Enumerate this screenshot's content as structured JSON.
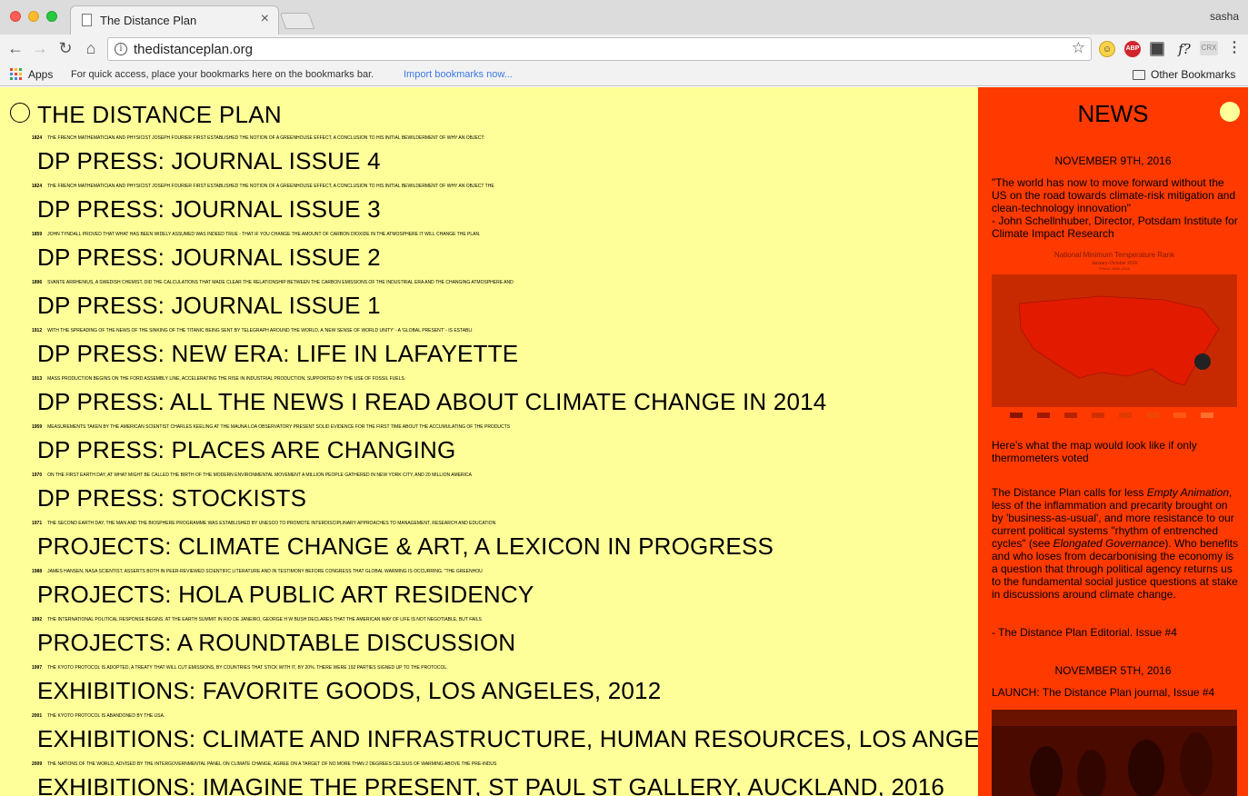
{
  "browser": {
    "tab_title": "The Distance Plan",
    "tab_close": "×",
    "profile_name": "sasha",
    "url": "thedistanceplan.org",
    "bookmarks_apps": "Apps",
    "bookmarks_hint": "For quick access, place your bookmarks here on the bookmarks bar.",
    "bookmarks_import": "Import bookmarks now...",
    "other_bookmarks": "Other Bookmarks",
    "ext_abp": "ABP",
    "ext_f": "f?",
    "ext_crx": "CRX",
    "icons": [
      "back-icon",
      "forward-icon",
      "reload-icon",
      "home-icon",
      "info-icon",
      "star-icon",
      "menu-icon"
    ]
  },
  "colors": {
    "left_bg": "#ffff99",
    "right_bg": "#ff3a00",
    "text": "#000000",
    "link_blue": "#3b78e7"
  },
  "site": {
    "title": "THE DISTANCE PLAN",
    "entries": [
      {
        "year": "1824",
        "note": "THE FRENCH MATHEMATICIAN AND PHYSICIST JOSEPH FOURIER FIRST ESTABLISHED THE NOTION OF A GREENHOUSE EFFECT, A CONCLUSION TO HIS INITIAL BEWILDERMENT OF WHY AN OBJECT:",
        "link": "DP PRESS: JOURNAL ISSUE 4"
      },
      {
        "year": "1824",
        "note": "THE FRENCH MATHEMATICIAN AND PHYSICIST JOSEPH FOURIER FIRST ESTABLISHED THE NOTION OF A GREENHOUSE EFFECT, A CONCLUSION TO HIS INITIAL BEWILDERMENT OF WHY AN OBJECT THE",
        "link": "DP PRESS: JOURNAL ISSUE 3"
      },
      {
        "year": "1859",
        "note": "JOHN TYNDALL PROVED THAT WHAT HAS BEEN WIDELY ASSUMED WAS INDEED TRUE - THAT IF YOU CHANGE THE AMOUNT OF CARBON DIOXIDE IN THE ATMOSPHERE IT WILL CHANGE THE PLAN.",
        "link": "DP PRESS: JOURNAL ISSUE 2"
      },
      {
        "year": "1896",
        "note": "SVANTE ARRHENIUS, A SWEDISH CHEMIST, DID THE CALCULATIONS THAT MADE CLEAR THE RELATIONSHIP BETWEEN THE CARBON EMISSIONS OF THE INDUSTRIAL ERA AND THE CHANGING ATMOSPHERE AND",
        "link": "DP PRESS: JOURNAL ISSUE 1"
      },
      {
        "year": "1912",
        "note": "WITH THE SPREADING OF THE NEWS OF THE SINKING OF THE TITANIC BEING SENT BY TELEGRAPH AROUND THE WORLD, A 'NEW SENSE OF WORLD UNITY' - A 'GLOBAL PRESENT' - IS ESTABLI",
        "link": "DP PRESS: NEW ERA: LIFE IN LAFAYETTE"
      },
      {
        "year": "1913",
        "note": "MASS PRODUCTION BEGINS ON THE FORD ASSEMBLY LINE, ACCELERATING THE RISE IN INDUSTRIAL PRODUCTION, SUPPORTED BY THE USE OF FOSSIL FUELS.",
        "link": "DP PRESS: ALL THE NEWS I READ ABOUT CLIMATE CHANGE IN 2014"
      },
      {
        "year": "1959",
        "note": "MEASUREMENTS TAKEN BY THE AMERICAN SCIENTIST CHARLES KEELING AT THE MAUNA LOA OBSERVATORY PRESENT SOLID EVIDENCE FOR THE FIRST TIME ABOUT THE ACCUMULATING OF THE PRODUCTS",
        "link": "DP PRESS: PLACES ARE CHANGING"
      },
      {
        "year": "1970",
        "note": "ON THE FIRST EARTH DAY, AT WHAT MIGHT BE CALLED THE BIRTH OF THE MODERN ENVIRONMENTAL MOVEMENT A MILLION PEOPLE GATHERED IN NEW YORK CITY, AND 20 MILLION AMERICA",
        "link": "DP PRESS: STOCKISTS"
      },
      {
        "year": "1971",
        "note": "THE SECOND EARTH DAY, THE MAN AND THE BIOSPHERE PROGRAMME WAS ESTABLISHED BY UNESCO TO PROMOTE INTERDISCIPLINARY APPROACHES TO MANAGEMENT, RESEARCH AND EDUCATION",
        "link": "PROJECTS: CLIMATE CHANGE & ART, A LEXICON IN PROGRESS"
      },
      {
        "year": "1988",
        "note": "JAMES HANSEN, NASA SCIENTIST, ASSERTS BOTH IN PEER-REVIEWED SCIENTIFIC LITERATURE AND IN TESTIMONY BEFORE CONGRESS THAT GLOBAL WARMING IS OCCURRING. \"THE GREENHOU",
        "link": "PROJECTS: HOLA PUBLIC ART RESIDENCY"
      },
      {
        "year": "1992",
        "note": "THE INTERNATIONAL POLITICAL RESPONSE BEGINS. AT THE EARTH SUMMIT IN RIO DE JANEIRO, GEORGE H W BUSH DECLARES THAT THE AMERICAN WAY OF LIFE IS NOT NEGOTIABLE, BUT FAILS",
        "link": "PROJECTS: A ROUNDTABLE DISCUSSION"
      },
      {
        "year": "1997",
        "note": "THE KYOTO PROTOCOL IS ADOPTED, A TREATY THAT WILL CUT EMISSIONS, BY COUNTRIES THAT STICK WITH IT, BY 20%. THERE WERE 192 PARTIES SIGNED UP TO THE PROTOCOL.",
        "link": "EXHIBITIONS: FAVORITE GOODS, LOS ANGELES, 2012"
      },
      {
        "year": "2001",
        "note": "THE KYOTO PROTOCOL IS ABANDONED BY THE USA.",
        "link": "EXHIBITIONS: CLIMATE AND INFRASTRUCTURE, HUMAN RESOURCES, LOS ANGELES"
      },
      {
        "year": "2009",
        "note": "THE NATIONS OF THE WORLD, ADVISED BY THE INTERGOVERNMENTAL PANEL ON CLIMATE CHANGE, AGREE ON A TARGET OF NO MORE THAN 2 DEGREES CELSIUS OF WARMING ABOVE THE PRE-INDUS",
        "link": "EXHIBITIONS: IMAGINE THE PRESENT, ST PAUL ST GALLERY, AUCKLAND, 2016"
      }
    ]
  },
  "news": {
    "heading": "NEWS",
    "item1_date": "NOVEMBER 9TH, 2016",
    "item1_quote": "\"The world has now to move forward without the US on the road towards climate-risk mitigation and clean-technology innovation\"",
    "item1_attrib": "- John Schellnhuber, Director, Potsdam Institute for Climate Impact Research",
    "map_title": "National Minimum Temperature Rank",
    "map_subtitle": "January–October 2016",
    "map_period": "Period: 1895–2016",
    "map_caption": "Here's what the map would look like if only thermometers voted",
    "editorial_p1": "The Distance Plan calls for less ",
    "editorial_em1": "Empty Animation",
    "editorial_p2": ", less of the inflammation and precarity brought on by 'business-as-usual', and more resistance to our current political systems \"rhythm of entrenched cycles\" (see ",
    "editorial_em2": "Elongated Governance",
    "editorial_p3": "). Who benefits and who loses from decarbonising the economy is a question that through political agency returns us to the fundamental social justice questions at stake in discussions around climate change.",
    "editorial_sign": "- The Distance Plan Editorial. Issue #4",
    "item2_date": "NOVEMBER 5TH, 2016",
    "item2_text": "LAUNCH: The Distance Plan journal, Issue #4"
  }
}
